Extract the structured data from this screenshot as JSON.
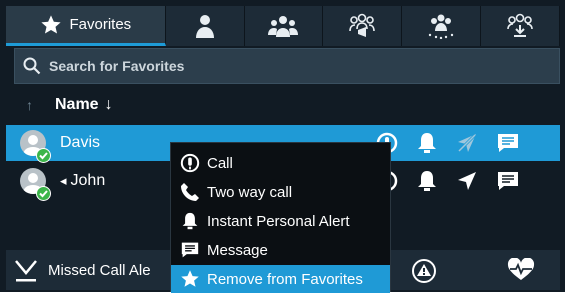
{
  "tabs": {
    "favorites_label": "Favorites",
    "items": [
      "contacts-person",
      "contacts-group",
      "broadcast-group",
      "dynamic-group",
      "download-group"
    ]
  },
  "search": {
    "placeholder": "Search for Favorites"
  },
  "list_header": {
    "sort_asc_glyph": "↑",
    "name_label": "Name",
    "sort_desc_glyph": "↓"
  },
  "contacts": [
    {
      "name": "Davis",
      "status": "online",
      "selected": true
    },
    {
      "name": "John",
      "status": "online",
      "prefix_glyph": "◂",
      "selected": false
    }
  ],
  "bottom": {
    "missed_label": "Missed Call Ale"
  },
  "context_menu": {
    "items": [
      {
        "label": "Call",
        "icon": "call-icon"
      },
      {
        "label": "Two way call",
        "icon": "phone-icon"
      },
      {
        "label": "Instant Personal Alert",
        "icon": "bell-icon"
      },
      {
        "label": "Message",
        "icon": "message-icon"
      },
      {
        "label": "Remove from Favorites",
        "icon": "star-icon",
        "highlighted": true
      }
    ]
  },
  "colors": {
    "accent": "#1f9ad6",
    "background": "#111b24",
    "panel": "#1d2b37",
    "online": "#3cb54a"
  }
}
